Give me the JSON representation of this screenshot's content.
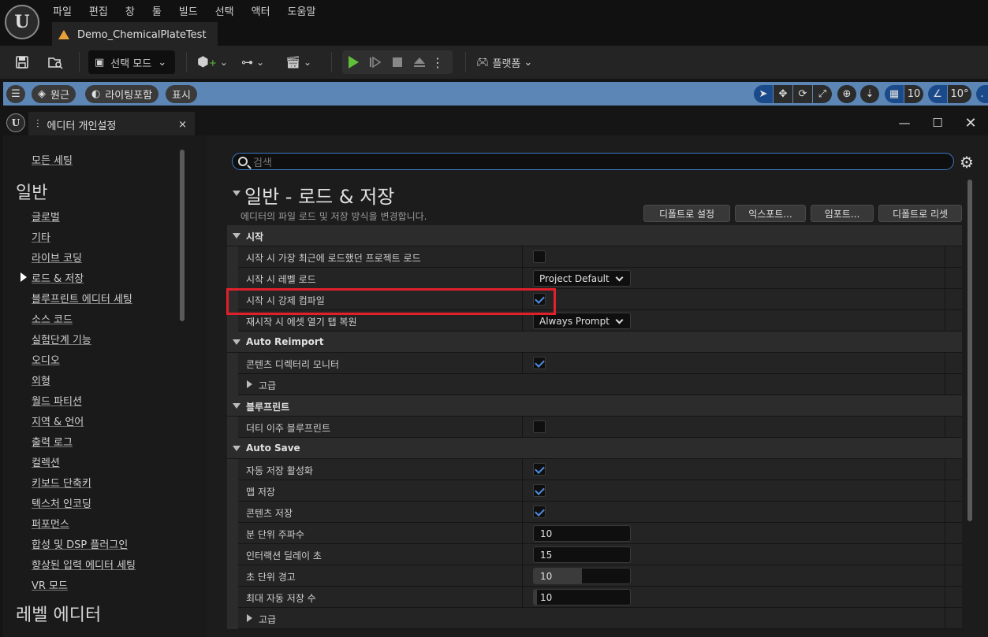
{
  "menubar": [
    "파일",
    "편집",
    "창",
    "툴",
    "빌드",
    "선택",
    "액터",
    "도움말"
  ],
  "level_tab": "Demo_ChemicalPlateTest",
  "toolbar": {
    "mode_label": "선택 모드",
    "platform_label": "플랫폼"
  },
  "viewport": {
    "perspective": "원근",
    "lighting": "라이팅포함",
    "show": "표시",
    "grid_snap": "10",
    "rotate_snap": "10°"
  },
  "prefs": {
    "tab_title": "에디터 개인설정",
    "search_placeholder": "검색",
    "section_title": "일반 - 로드 & 저장",
    "section_desc": "에디터의 파일 로드 및 저장 방식을 변경합니다.",
    "buttons": [
      "디폴트로 설정",
      "익스포트...",
      "임포트...",
      "디폴트로 리셋"
    ]
  },
  "nav": {
    "all_settings": "모든 세팅",
    "category_general": "일반",
    "items": [
      "글로벌",
      "기타",
      "라이브 코딩",
      "로드 & 저장",
      "블루프린트 에디터 세팅",
      "소스 코드",
      "실험단계 기능",
      "오디오",
      "외형",
      "월드 파티션",
      "지역 & 언어",
      "출력 로그",
      "컬렉션",
      "키보드 단축키",
      "텍스처 인코딩",
      "퍼포먼스",
      "합성 및 DSP 플러그인",
      "향상된 입력 에디터 세팅",
      "VR 모드"
    ],
    "selected": "로드 & 저장",
    "category_level_editor": "레벨 에디터"
  },
  "rows": [
    {
      "kind": "cat",
      "label": "시작"
    },
    {
      "kind": "prop",
      "label": "시작 시 가장 최근에 로드했던 프로젝트 로드",
      "control": "check",
      "value": false
    },
    {
      "kind": "prop",
      "label": "시작 시 레벨 로드",
      "control": "dropdown",
      "value": "Project Default"
    },
    {
      "kind": "prop",
      "label": "시작 시 강제 컴파일",
      "control": "check",
      "value": true
    },
    {
      "kind": "prop",
      "label": "재시작 시 에셋 열기 탭 복원",
      "control": "dropdown",
      "value": "Always Prompt"
    },
    {
      "kind": "cat",
      "label": "Auto Reimport"
    },
    {
      "kind": "prop",
      "label": "콘텐츠 디렉터리 모니터",
      "control": "check",
      "value": true
    },
    {
      "kind": "sub",
      "label": "고급"
    },
    {
      "kind": "cat",
      "label": "블루프린트"
    },
    {
      "kind": "prop",
      "label": "더티 이주 블루프린트",
      "control": "check",
      "value": false
    },
    {
      "kind": "cat",
      "label": "Auto Save"
    },
    {
      "kind": "prop",
      "label": "자동 저장 활성화",
      "control": "check",
      "value": true
    },
    {
      "kind": "prop",
      "label": "맵 저장",
      "control": "check",
      "value": true
    },
    {
      "kind": "prop",
      "label": "콘텐츠 저장",
      "control": "check",
      "value": true
    },
    {
      "kind": "prop",
      "label": "분 단위 주파수",
      "control": "number",
      "value": "10",
      "fill": 0
    },
    {
      "kind": "prop",
      "label": "인터랙션 딜레이 초",
      "control": "number",
      "value": "15",
      "fill": 0
    },
    {
      "kind": "prop",
      "label": "초 단위 경고",
      "control": "number",
      "value": "10",
      "fill": 0.5
    },
    {
      "kind": "prop",
      "label": "최대 자동 저장 수",
      "control": "number",
      "value": "10",
      "fill": 0.03
    },
    {
      "kind": "sub",
      "label": "고급"
    }
  ],
  "colors": {
    "accent": "#4d8de0",
    "highlight": "#e0202a",
    "play": "#5fbf3a",
    "viewport_bar": "#5b86b6"
  }
}
